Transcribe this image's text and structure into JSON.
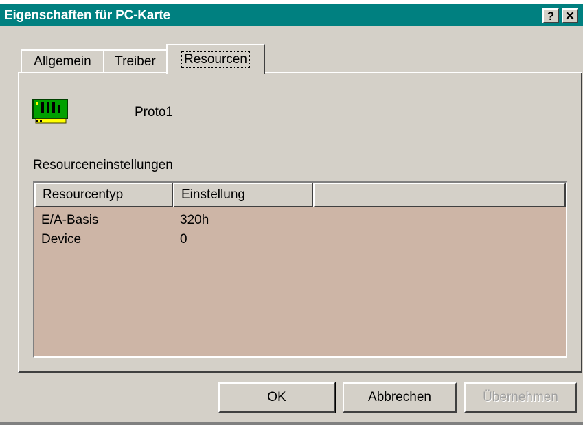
{
  "window": {
    "title": "Eigenschaften für PC-Karte",
    "help_label": "?",
    "close_label": "✕"
  },
  "tabs": [
    {
      "label": "Allgemein"
    },
    {
      "label": "Treiber"
    },
    {
      "label": "Resourcen"
    }
  ],
  "device": {
    "name": "Proto1",
    "icon": "pc-card-icon"
  },
  "resources": {
    "group_label": "Resourceneinstellungen",
    "columns": [
      "Resourcentyp",
      "Einstellung",
      ""
    ],
    "rows": [
      {
        "type": "E/A-Basis",
        "setting": "320h"
      },
      {
        "type": "Device",
        "setting": "0"
      }
    ]
  },
  "buttons": {
    "ok": "OK",
    "cancel": "Abbrechen",
    "apply": "Übernehmen"
  },
  "colors": {
    "titlebar": "#008080",
    "face": "#d4d0c8",
    "list_background": "#cdb5a6"
  }
}
